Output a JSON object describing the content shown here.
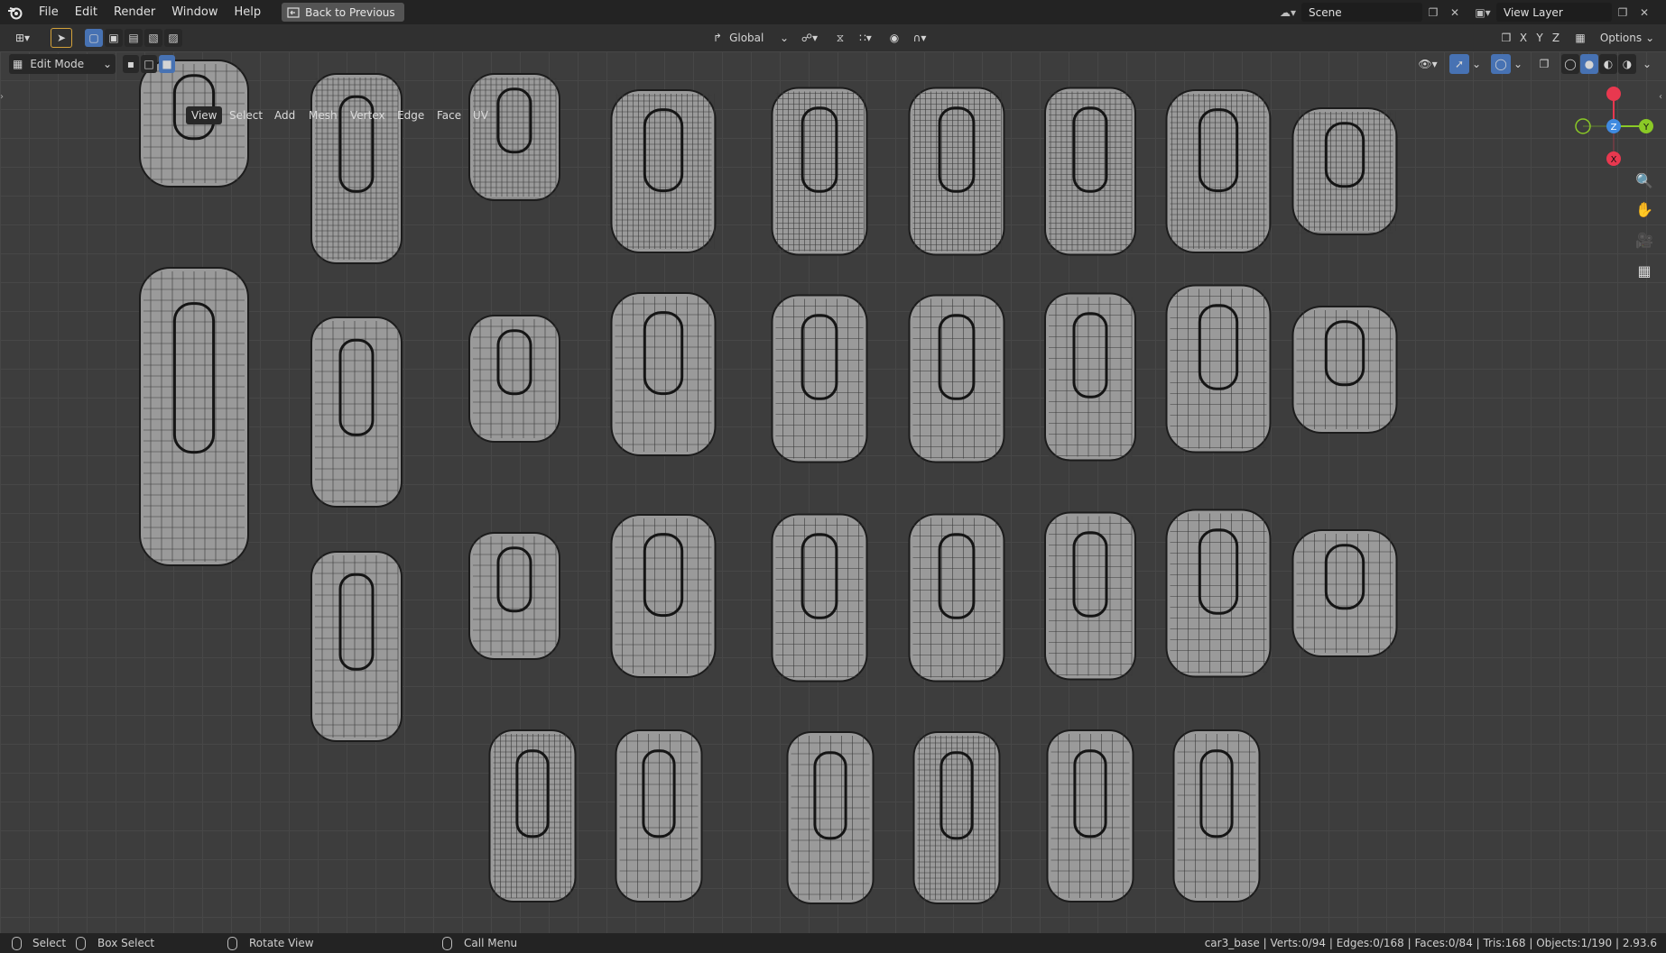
{
  "menu": {
    "file": "File",
    "edit": "Edit",
    "render": "Render",
    "window": "Window",
    "help": "Help",
    "back": "Back to Previous"
  },
  "scene": {
    "name": "Scene"
  },
  "view_layer": {
    "name": "View Layer"
  },
  "tool_header": {
    "orientation": "Global",
    "axes": [
      "X",
      "Y",
      "Z"
    ],
    "options": "Options"
  },
  "view_header": {
    "mode": "Edit Mode",
    "menus": [
      "View",
      "Select",
      "Add",
      "Mesh",
      "Vertex",
      "Edge",
      "Face",
      "UV"
    ]
  },
  "gizmo": {
    "x": "X",
    "y": "Y",
    "z": "Z"
  },
  "colors": {
    "x_axis": "#e8384f",
    "y_axis": "#8ac926",
    "z_axis": "#3f8ae0",
    "accent": "#4772b3"
  },
  "statusbar": {
    "select": "Select",
    "box_select": "Box Select",
    "rotate_view": "Rotate View",
    "call_menu": "Call Menu",
    "stats": "car3_base | Verts:0/94 | Edges:0/168 | Faces:0/84 | Tris:168 | Objects:1/190 | 2.93.6"
  }
}
